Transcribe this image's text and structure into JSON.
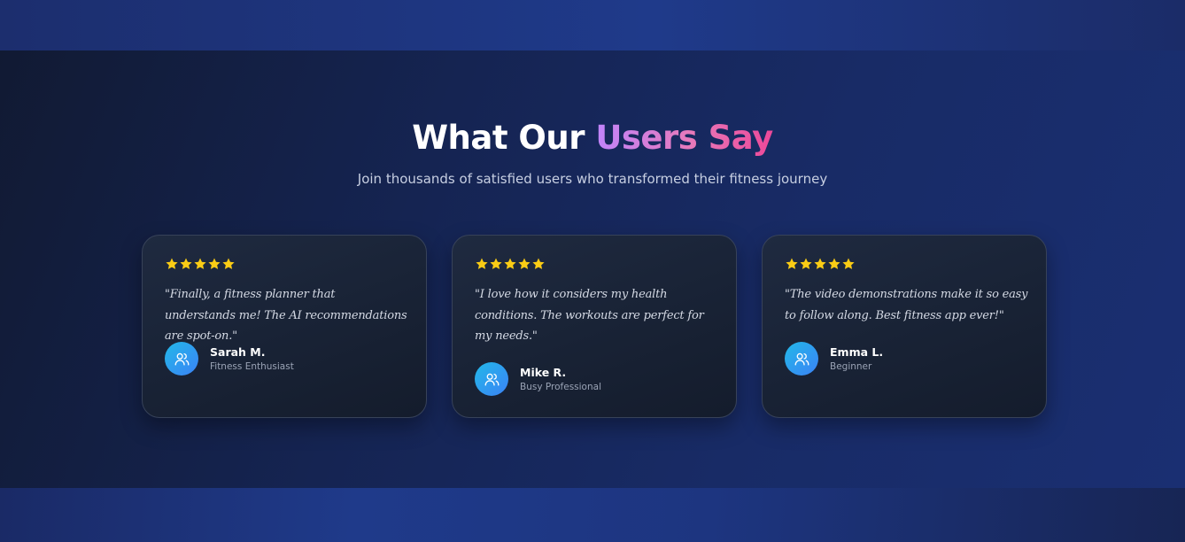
{
  "section": {
    "heading_prefix": "What Our ",
    "heading_accent": "Users Say",
    "subheading": "Join thousands of satisfied users who transformed their fitness journey"
  },
  "colors": {
    "star": "#facc15",
    "accent_gradient_start": "#c084fc",
    "accent_gradient_end": "#ec4899",
    "avatar_gradient_start": "#22b8e8",
    "avatar_gradient_end": "#3b82f6"
  },
  "testimonials": [
    {
      "rating": 5,
      "max_rating": 5,
      "quote": "\"Finally, a fitness planner that understands me! The AI recommendations are spot-on.\"",
      "name": "Sarah M.",
      "role": "Fitness Enthusiast",
      "avatar_icon": "users-icon"
    },
    {
      "rating": 5,
      "max_rating": 5,
      "quote": "\"I love how it considers my health conditions. The workouts are perfect for my needs.\"",
      "name": "Mike R.",
      "role": "Busy Professional",
      "avatar_icon": "users-icon"
    },
    {
      "rating": 5,
      "max_rating": 5,
      "quote": "\"The video demonstrations make it so easy to follow along. Best fitness app ever!\"",
      "name": "Emma L.",
      "role": "Beginner",
      "avatar_icon": "users-icon"
    }
  ]
}
